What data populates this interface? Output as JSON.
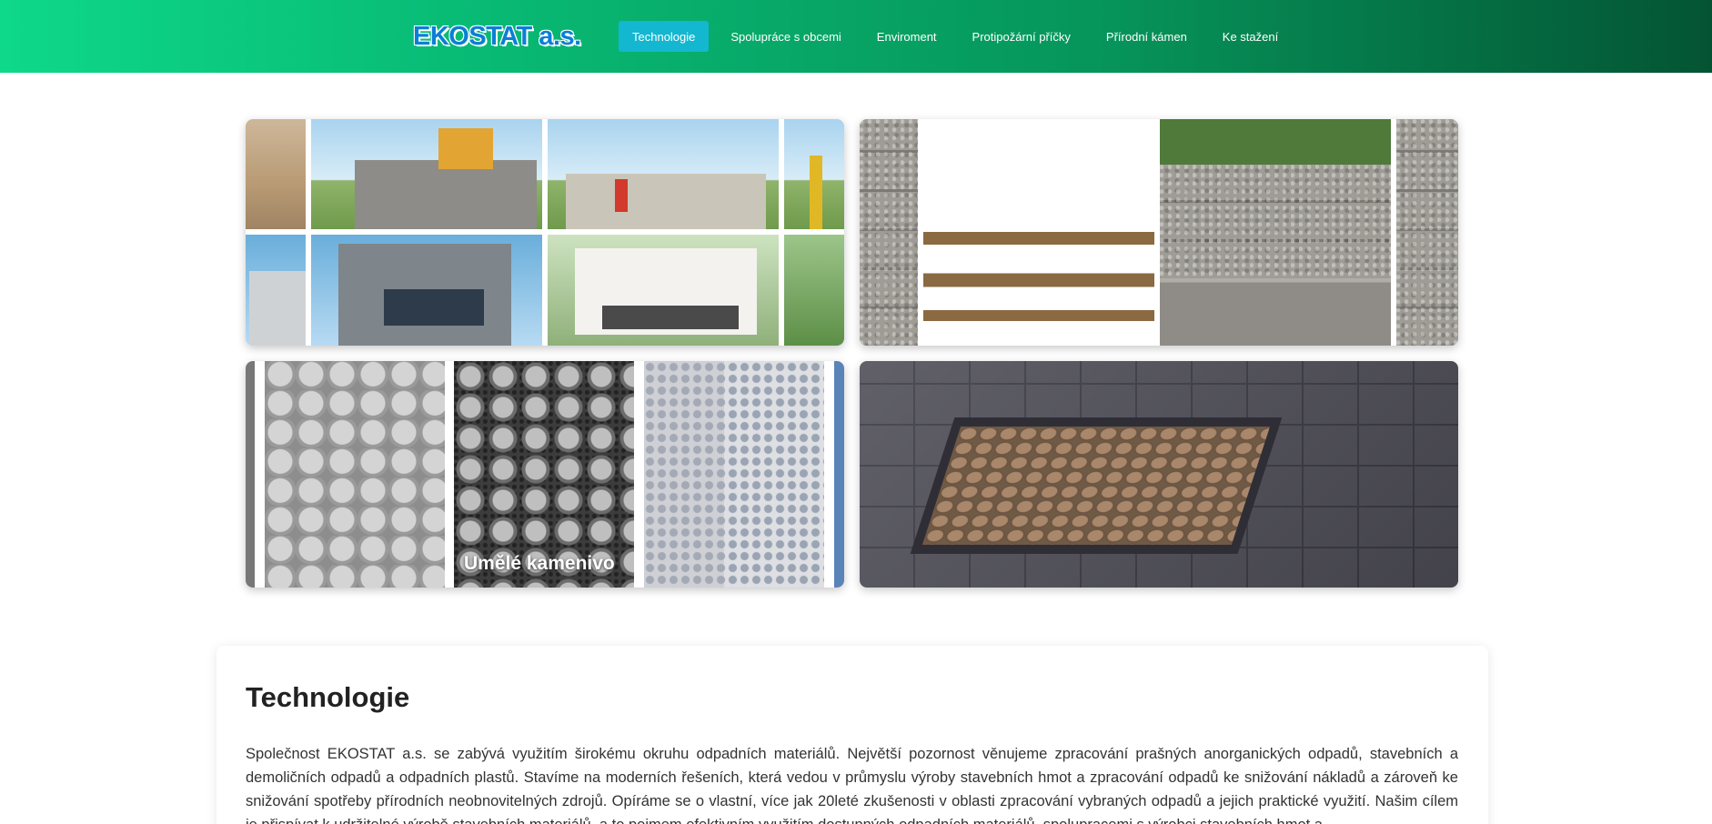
{
  "header": {
    "logo_text": "EKOSTAT a.s.",
    "nav": [
      {
        "label": "Technologie",
        "active": true
      },
      {
        "label": "Spolupráce s obcemi",
        "active": false
      },
      {
        "label": "Enviroment",
        "active": false
      },
      {
        "label": "Protipožární příčky",
        "active": false
      },
      {
        "label": "Přírodní kámen",
        "active": false
      },
      {
        "label": "Ke stažení",
        "active": false
      }
    ],
    "colors": {
      "gradient_start": "#0ed88a",
      "gradient_end": "#045433",
      "active_item": "#13b7d0",
      "logo": "#0a7fd6"
    }
  },
  "gallery": {
    "tiles": [
      {
        "subject": "construction-and-houses"
      },
      {
        "subject": "natural-stone"
      },
      {
        "subject": "artificial-aggregate",
        "caption": "Umělé kamenivo"
      },
      {
        "subject": "paving"
      }
    ]
  },
  "content": {
    "title": "Technologie",
    "paragraph": "Společnost EKOSTAT a.s. se zabývá využitím širokému okruhu odpadních materiálů. Největší pozornost věnujeme zpracování prašných anorganických odpadů, stavebních a demoličních odpadů a odpadních plastů. Stavíme na moderních řešeních, která vedou v průmyslu výroby stavebních hmot a zpracování odpadů ke snižování nákladů a zároveň ke snižování spotřeby přírodních neobnovitelných zdrojů. Opíráme se o vlastní, více jak 20leté zkušenosti v oblasti zpracování vybraných odpadů a jejich praktické využití. Našim cílem je přispívat k udržitelné výrobě stavebních materiálů, a to pojmem efektivním využitím dostupných odpadních materiálů, spolupracemi s výrobci stavebních hmot a"
  }
}
